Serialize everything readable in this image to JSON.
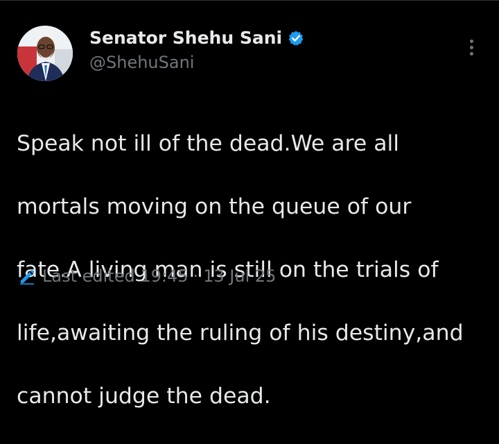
{
  "colors": {
    "background": "#000000",
    "primary_text": "#e7e9ea",
    "secondary_text": "#71767b",
    "verified_blue": "#1d9bf0",
    "edit_icon_blue": "#1d9bf0"
  },
  "author": {
    "display_name": "Senator Shehu Sani",
    "handle": "@ShehuSani",
    "verified_icon": "verified-badge-icon",
    "avatar_icon": "avatar"
  },
  "menu": {
    "icon": "more-options-icon"
  },
  "tweet": {
    "lines": [
      "Speak not ill of the dead.We are all",
      "mortals moving on the queue of our",
      "fate.A living man is still on the trials of",
      "life,awaiting the ruling of his destiny,and",
      "cannot judge the dead."
    ]
  },
  "meta": {
    "edit_icon": "pencil-icon",
    "edited_label": "Last edited 19:45",
    "separator": "·",
    "date": "13 Jul 25"
  }
}
